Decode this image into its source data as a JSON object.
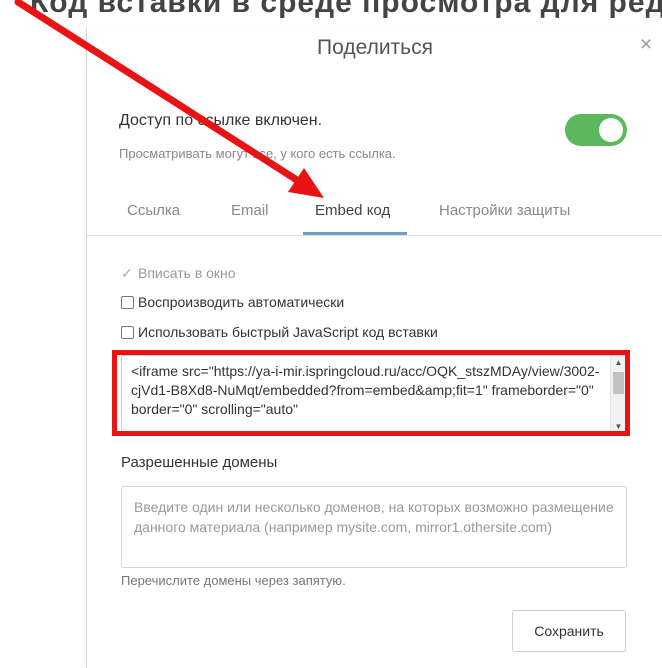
{
  "background": {
    "cropped_text": "Код вставки в среде просмотра для редактор"
  },
  "dialog": {
    "title": "Поделиться",
    "close_glyph": "×",
    "access": {
      "title": "Доступ по ссылке включен.",
      "subtitle": "Просматривать могут все, у кого есть ссылка.",
      "toggle_on": true
    },
    "tabs": [
      {
        "label": "Ссылка"
      },
      {
        "label": "Email"
      },
      {
        "label": "Embed код"
      },
      {
        "label": "Настройки защиты"
      }
    ],
    "active_tab": "Embed код",
    "options": [
      {
        "label": "Вписать в окно",
        "checked": true,
        "disabled": true
      },
      {
        "label": "Воспроизводить автоматически",
        "checked": false,
        "disabled": false
      },
      {
        "label": "Использовать быстрый JavaScript код вставки",
        "checked": false,
        "disabled": false
      }
    ],
    "embed_code": "<iframe src=\"https://ya-i-mir.ispringcloud.ru/acc/OQK_stszMDAy/view/3002-cjVd1-B8Xd8-NuMqt/embedded?from=embed&amp;fit=1\" frameborder=\"0\" border=\"0\" scrolling=\"auto\"",
    "allowed_domains": {
      "label": "Разрешенные домены",
      "placeholder": "Введите один или несколько доменов, на которых возможно размещение данного материала (например mysite.com, mirror1.othersite.com)",
      "value": "",
      "hint": "Перечислите домены через запятую."
    },
    "save_label": "Сохранить"
  },
  "colors": {
    "toggle_on": "#5cb85c",
    "tab_underline": "#6aa3c9",
    "annotation_red": "#e81313"
  }
}
